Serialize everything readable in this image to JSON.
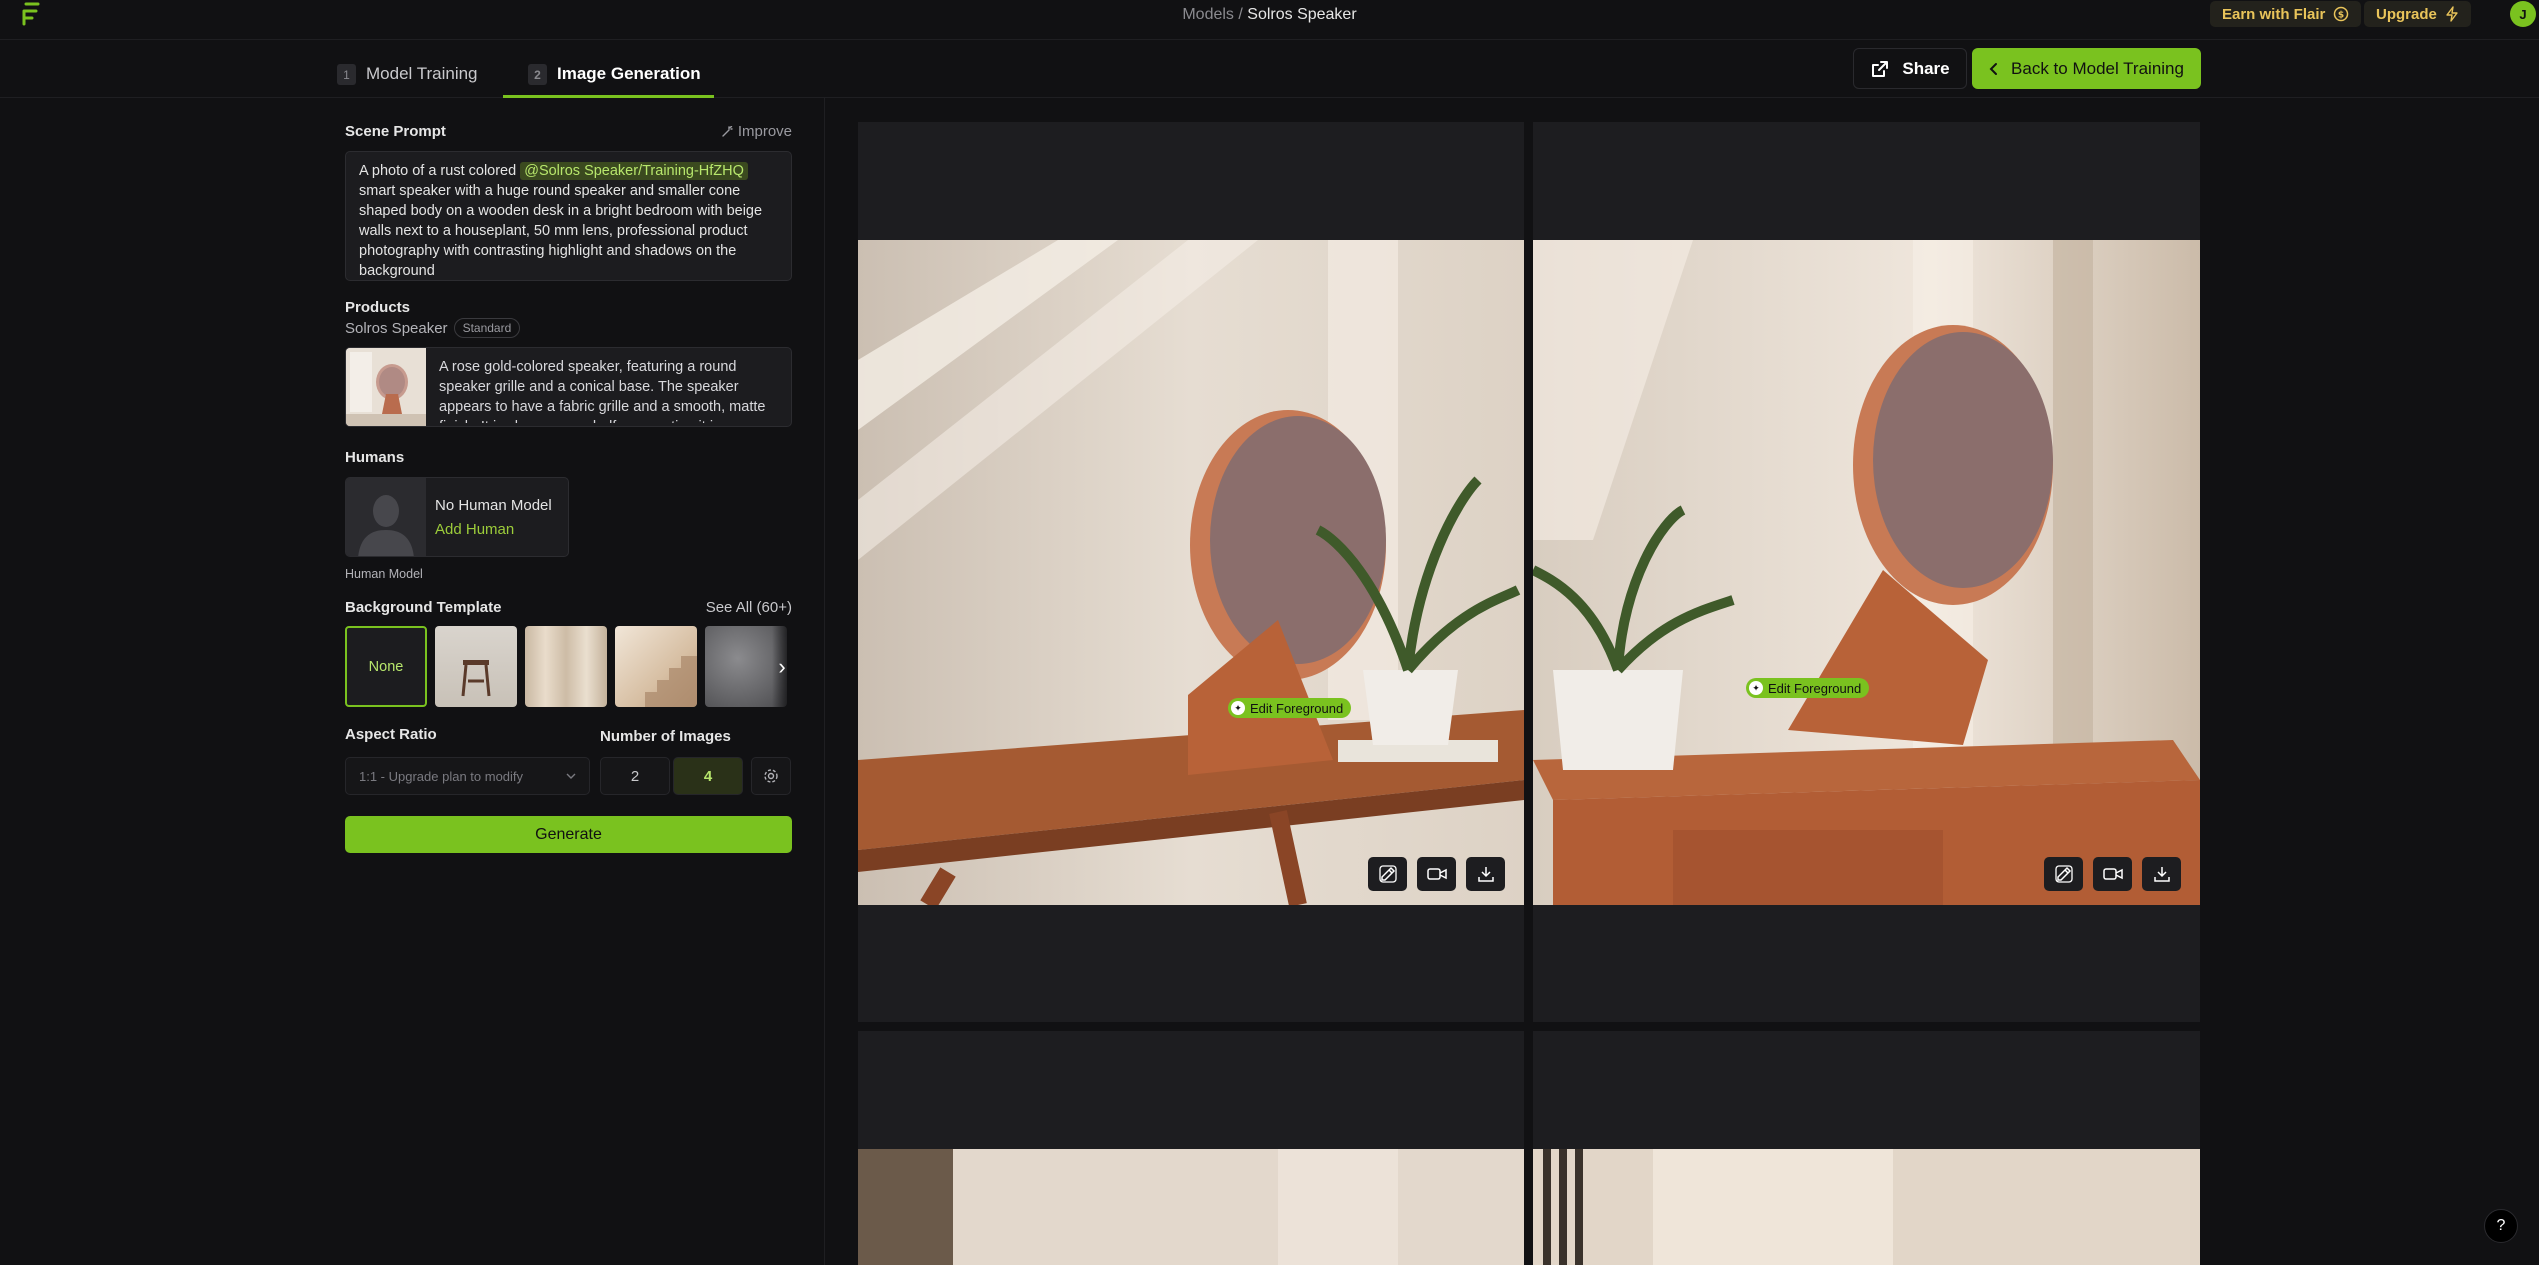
{
  "topbar": {
    "breadcrumb_parent": "Models",
    "breadcrumb_sep": " / ",
    "breadcrumb_current": "Solros Speaker",
    "earn_label": "Earn with Flair",
    "upgrade_label": "Upgrade",
    "avatar_initial": "J"
  },
  "tabs": [
    {
      "num": "1",
      "label": "Model Training"
    },
    {
      "num": "2",
      "label": "Image Generation"
    }
  ],
  "actions": {
    "share_label": "Share",
    "back_label": "Back to Model Training"
  },
  "scene": {
    "label": "Scene Prompt",
    "improve_label": "Improve",
    "prompt_before": "A photo of a rust colored ",
    "prompt_mention": "@Solros Speaker/Training-HfZHQ",
    "prompt_after": " smart speaker with a huge round speaker and smaller cone shaped body on a wooden desk in a bright bedroom with beige walls next to a houseplant, 50 mm lens, professional product photography with contrasting highlight and shadows on the background"
  },
  "products": {
    "label": "Products",
    "name": "Solros Speaker",
    "badge": "Standard",
    "description": "A rose gold-colored speaker, featuring a round speaker grille and a conical base. The speaker appears to have a fabric grille and a smooth, matte finish. It is shown on a shelf, suggesting it is"
  },
  "humans": {
    "label": "Humans",
    "title": "No Human Model",
    "add_label": "Add Human",
    "caption": "Human Model"
  },
  "background": {
    "label": "Background Template",
    "see_all": "See All (60+)",
    "none_label": "None"
  },
  "aspect": {
    "label": "Aspect Ratio",
    "value": "1:1 - Upgrade plan to modify"
  },
  "num_images": {
    "label": "Number of Images",
    "options": [
      "2",
      "4"
    ],
    "selected": "4"
  },
  "generate_label": "Generate",
  "gallery": {
    "edit_foreground_label": "Edit Foreground"
  },
  "help_label": "?",
  "colors": {
    "accent": "#7ac21f",
    "background": "#111113",
    "panel": "#1c1c1f",
    "gold": "#e9c45a"
  }
}
